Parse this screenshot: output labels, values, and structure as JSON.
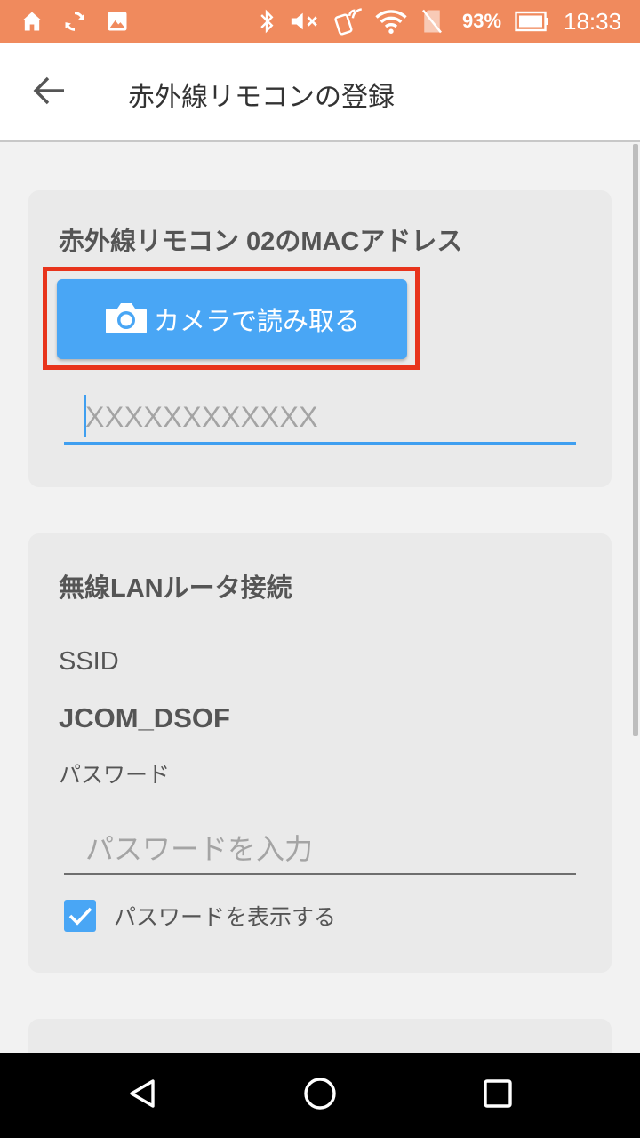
{
  "status_bar": {
    "battery_percent": "93%",
    "time": "18:33",
    "left_icons": [
      "home-icon",
      "sync-icon",
      "image-icon"
    ],
    "right_icons": [
      "bluetooth-icon",
      "mute-icon",
      "nfc-icon",
      "wifi-icon",
      "no-sim-icon",
      "battery-icon"
    ],
    "background_color": "#f08a5d"
  },
  "app_bar": {
    "title": "赤外線リモコンの登録",
    "back_icon": "arrow-back-icon"
  },
  "mac_card": {
    "heading": "赤外線リモコン 02のMACアドレス",
    "camera_button_label": "カメラで読み取る",
    "camera_icon": "camera-icon",
    "mac_input_placeholder": "XXXXXXXXXXXX",
    "mac_input_value": "",
    "highlight_color": "#e8341c",
    "button_color": "#49a6f5"
  },
  "wifi_card": {
    "heading": "無線LANルータ接続",
    "ssid_label": "SSID",
    "ssid_value": "JCOM_DSOF",
    "password_label": "パスワード",
    "password_placeholder": "パスワードを入力",
    "password_value": "",
    "show_password_label": "パスワードを表示する",
    "show_password_checked": true
  },
  "nav_bar": {
    "buttons": [
      "back-triangle-icon",
      "home-circle-icon",
      "recents-square-icon"
    ]
  }
}
